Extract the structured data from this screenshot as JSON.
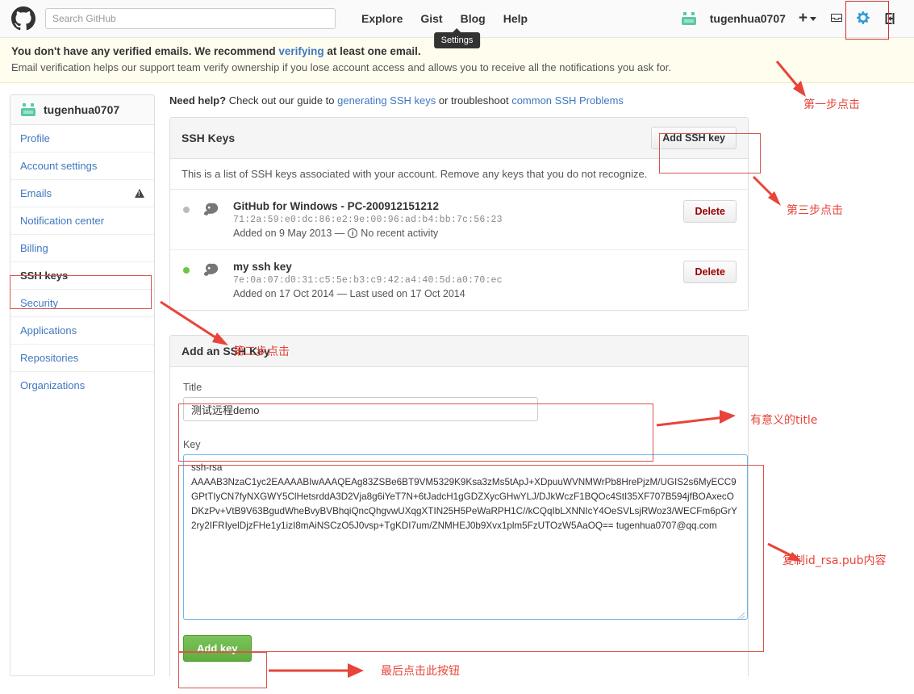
{
  "header": {
    "logo_icon": "github-octocat-icon",
    "search_placeholder": "Search GitHub",
    "search_value": "",
    "nav": [
      {
        "label": "Explore"
      },
      {
        "label": "Gist"
      },
      {
        "label": "Blog"
      },
      {
        "label": "Help"
      }
    ],
    "username": "tugenhua0707",
    "create_new_label": "+",
    "inbox_icon": "inbox-icon",
    "settings_icon": "gear-icon",
    "signout_icon": "sign-out-icon",
    "tooltip": "Settings"
  },
  "flash": {
    "line1_part1": "You don't have any verified emails. We recommend ",
    "line1_link": "verifying",
    "line1_part2": " at least one email.",
    "line2": "Email verification helps our support team verify ownership if you lose account access and allows you to receive all the notifications you ask for."
  },
  "sidebar": {
    "account_name": "tugenhua0707",
    "avatar_icon": "identicon-avatar",
    "items": [
      {
        "label": "Profile",
        "active": false,
        "badge": ""
      },
      {
        "label": "Account settings",
        "active": false,
        "badge": ""
      },
      {
        "label": "Emails",
        "active": false,
        "badge": "warning-triangle-icon"
      },
      {
        "label": "Notification center",
        "active": false,
        "badge": ""
      },
      {
        "label": "Billing",
        "active": false,
        "badge": ""
      },
      {
        "label": "SSH keys",
        "active": true,
        "badge": ""
      },
      {
        "label": "Security",
        "active": false,
        "badge": ""
      },
      {
        "label": "Applications",
        "active": false,
        "badge": ""
      },
      {
        "label": "Repositories",
        "active": false,
        "badge": ""
      },
      {
        "label": "Organizations",
        "active": false,
        "badge": ""
      }
    ]
  },
  "main": {
    "need_help": {
      "prefix_bold": "Need help?",
      "text1": " Check out our guide to ",
      "link1": "generating SSH keys",
      "text2": " or troubleshoot ",
      "link2": "common SSH Problems"
    },
    "ssh_panel": {
      "title": "SSH Keys",
      "add_button": "Add SSH key",
      "description": "This is a list of SSH keys associated with your account. Remove any keys that you do not recognize.",
      "keys": [
        {
          "title": "GitHub for Windows - PC-200912151212",
          "fingerprint": "71:2a:59:e0:dc:86:e2:9e:00:96:ad:b4:bb:7c:56:23",
          "added": "Added on 9 May 2013 —",
          "activity": "No recent activity",
          "has_info_icon": true,
          "status_color": "#bbbbbb",
          "delete_label": "Delete"
        },
        {
          "title": "my ssh key",
          "fingerprint": "7e:0a:07:d0:31:c5:5e:b3:c9:42:a4:40:5d:a0:70:ec",
          "added": "Added on 17 Oct 2014 — Last used on 17 Oct 2014",
          "activity": "",
          "has_info_icon": false,
          "status_color": "#6cc644",
          "delete_label": "Delete"
        }
      ]
    },
    "add_form": {
      "section_title": "Add an SSH Key",
      "title_label": "Title",
      "title_value": "测试远程demo",
      "key_label": "Key",
      "key_value": "ssh-rsa\nAAAAB3NzaC1yc2EAAAABIwAAAQEAg83ZSBe6BT9VM5329K9Ksa3zMs5tApJ+XDpuuWVNMWrPb8HrePjzM/UGIS2s6MyECC9GPtTIyCN7fyNXGWY5ClHetsrddA3D2Vja8g6iYeT7N+6tJadcH1gGDZXycGHwYLJ/DJkWczF1BQOc4StI35XF707B594jfBOAxecODKzPv+VtB9V63BgudWheBvyBVBhqiQncQhgvwUXqgXTIN25H5PeWaRPH1C//kCQqIbLXNNIcY4OeSVLsjRWoz3/WECFm6pGrY2ry2IFRIyelDjzFHe1y1izI8mAiNSCzO5J0vsp+TgKDI7um/ZNMHEJ0b9Xvx1plm5FzUTOzW5AaOQ== tugenhua0707@qq.com",
      "submit_label": "Add key"
    }
  },
  "annotations": [
    {
      "text": "第一步点击",
      "name": "annotation-step-1"
    },
    {
      "text": "第三步点击",
      "name": "annotation-step-3"
    },
    {
      "text": "第二步点击",
      "name": "annotation-step-2"
    },
    {
      "text": "有意义的title",
      "name": "annotation-meaningful-title"
    },
    {
      "text": "复制id_rsa.pub内容",
      "name": "annotation-copy-pubkey"
    },
    {
      "text": "最后点击此按钮",
      "name": "annotation-final-click"
    }
  ],
  "colors": {
    "link": "#4078c0",
    "annotation_red": "#e8443a",
    "green_button": "#5fad3f",
    "active_dot": "#6cc644",
    "inactive_dot": "#bbbbbb"
  }
}
